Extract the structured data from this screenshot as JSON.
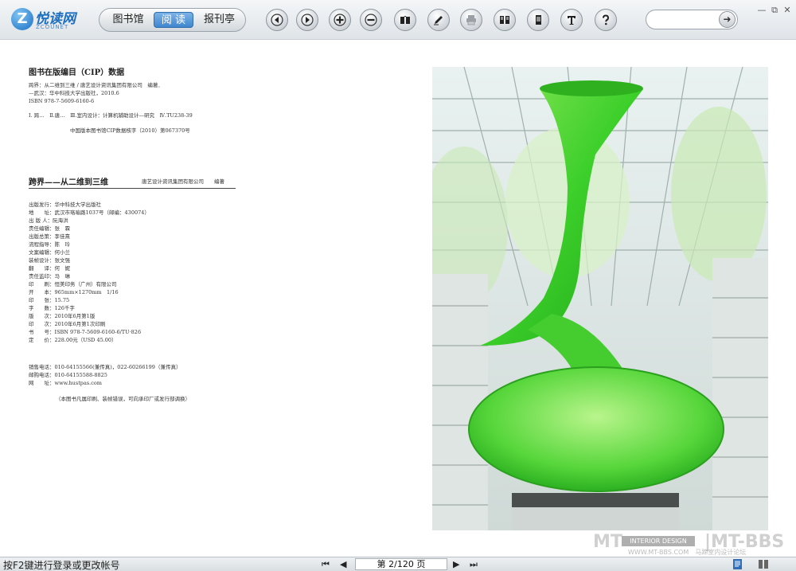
{
  "app": {
    "logo_text": "悦读网",
    "logo_sub": "ZCOUNET",
    "logo_letter": "Z"
  },
  "toolbar": {
    "tabs": [
      {
        "label": "图书馆",
        "active": false
      },
      {
        "label": "阅 读",
        "active": true
      },
      {
        "label": "报刊亭",
        "active": false
      }
    ],
    "buttons": [
      {
        "name": "prev-page-icon"
      },
      {
        "name": "next-page-icon"
      },
      {
        "name": "zoom-in-icon"
      },
      {
        "name": "zoom-out-icon"
      },
      {
        "name": "book-icon"
      },
      {
        "name": "pen-icon"
      },
      {
        "name": "print-icon"
      },
      {
        "name": "two-page-icon"
      },
      {
        "name": "single-page-icon"
      },
      {
        "name": "text-icon"
      },
      {
        "name": "help-icon"
      }
    ],
    "search_go": "➜",
    "window_controls": [
      "—",
      "⧉",
      "✕"
    ]
  },
  "page_left": {
    "cip_title": "图书在版编目（CIP）数据",
    "cip_lines": [
      "跨界：从二维到三维 / 唐艺设计资讯集团有限公司　编著．",
      "—武汉：华中科技大学出版社，2010.6",
      "ISBN 978-7-5609-6160-6"
    ],
    "classification": "Ⅰ. 跨…　Ⅱ.唐…　Ⅲ.室内设计：计算机辅助设计—研究　Ⅳ.TU238-39",
    "cip_number": "中国版本图书馆CIP数据核字（2010）第067370号",
    "book_title": "跨界——从二维到三维",
    "book_authors": "唐艺设计资讯集团有限公司　　编著",
    "colophon": [
      "出版发行：华中科技大学出版社",
      "地　　址：武汉市珞喻路1037号（邮编：430074）",
      "出 版 人：阮海洪",
      "责任编辑：张　霖",
      "出版总策：李佳熹",
      "流程指导：陈　玲",
      "文案编辑：何小兰",
      "装帧设计：张文强",
      "翻　　译：何　妮",
      "责任监印：马　琳",
      "印　　刷：恒美印务（广州）有限公司",
      "开　　本：965mm×1270mm　1/16",
      "印　　张：15.75",
      "字　　数：126千字",
      "版　　次：2010年6月第1版",
      "印　　次：2010年6月第1次印刷",
      "书　　号：ISBN 978-7-5609-6160-6/TU·826",
      "定　　价：228.00元（USD 45.00）"
    ],
    "contacts": [
      "销售电话：010-64155566(兼传真)，022-60266199（兼传真）",
      "邮购电话：010-64155588-8825",
      "网　　址：www.hustpas.com"
    ],
    "notice": "（本图书凡属印刷、装帧错误，可向承印厂或发行部调换）"
  },
  "statusbar": {
    "hint": "按F2键进行登录或更改帐号",
    "page_indicator": "第 2/120 页",
    "current_page": 2,
    "total_pages": 120,
    "nav_first": "⏮",
    "nav_prev": "◀",
    "nav_next": "▶",
    "nav_last": "⏭"
  },
  "watermark": {
    "mt": "MT",
    "box": "INTERIOR DESIGN",
    "bbs": "|MT-BBS",
    "url": "WWW.MT-BBS.COM　马蹄室内设计论坛"
  }
}
